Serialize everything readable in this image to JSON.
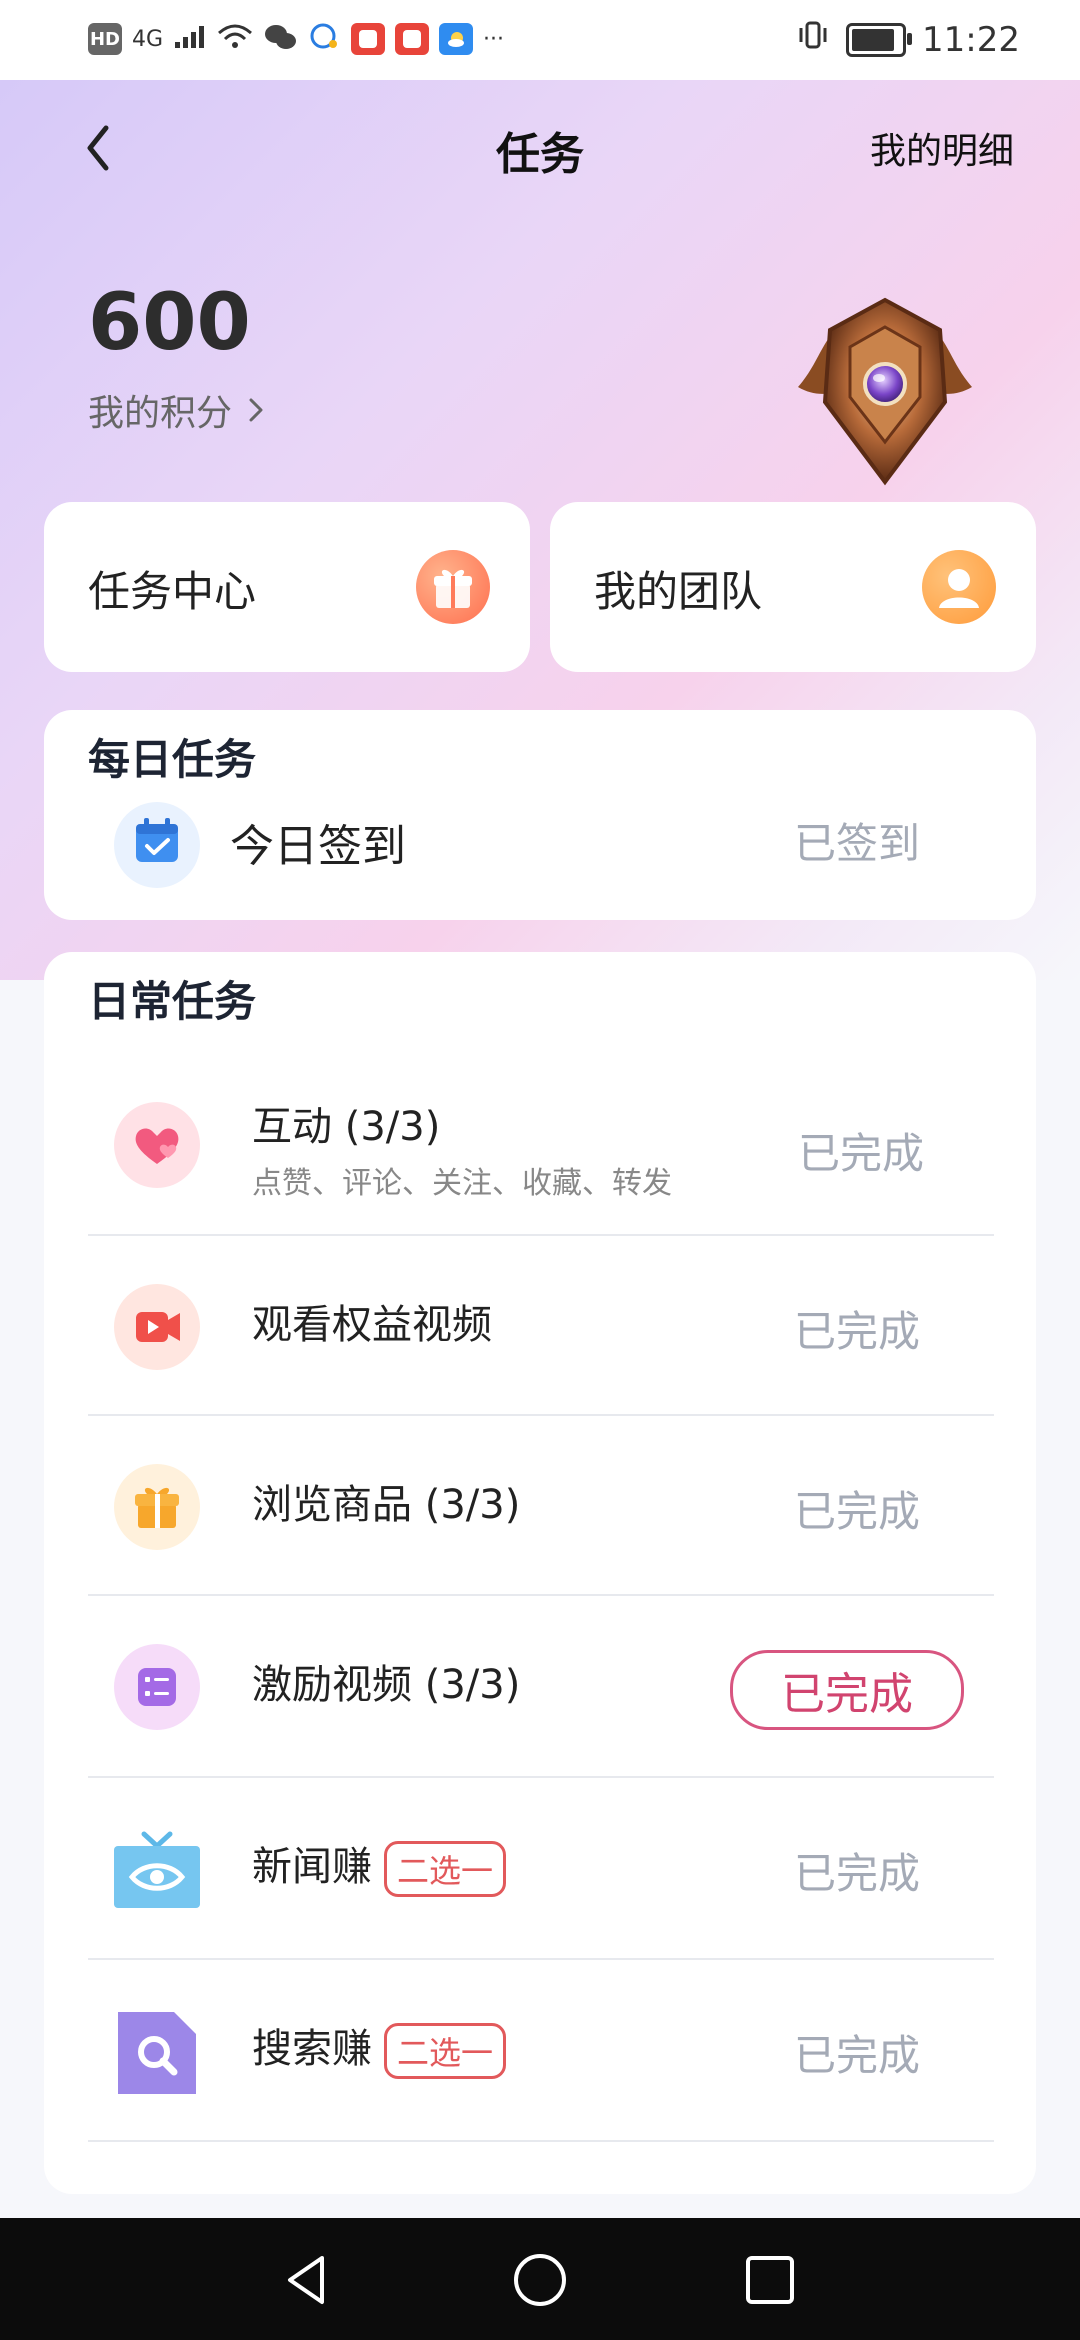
{
  "status_bar": {
    "left_badge": "HD",
    "signal": "4G",
    "right_time": "11:22",
    "dots": "···"
  },
  "header": {
    "title": "任务",
    "detail_link": "我的明细"
  },
  "points": {
    "value": "600",
    "label": "我的积分"
  },
  "quick_actions": [
    {
      "label": "任务中心",
      "icon": "gift-icon"
    },
    {
      "label": "我的团队",
      "icon": "person-icon"
    }
  ],
  "daily": {
    "title": "每日任务",
    "items": [
      {
        "title": "今日签到",
        "status": "已签到",
        "icon": "calendar-check-icon"
      }
    ]
  },
  "routine": {
    "title": "日常任务",
    "items": [
      {
        "title": "互动 (3/3)",
        "subtitle": "点赞、评论、关注、收藏、转发",
        "status": "已完成",
        "icon": "heart-icon"
      },
      {
        "title": "观看权益视频",
        "status": "已完成",
        "icon": "video-icon"
      },
      {
        "title": "浏览商品 (3/3)",
        "status": "已完成",
        "icon": "gift-icon"
      },
      {
        "title": "激励视频 (3/3)",
        "status": "已完成",
        "icon": "list-icon",
        "highlight": true
      },
      {
        "title": "新闻赚",
        "tag": "二选一",
        "status": "已完成",
        "icon": "tv-icon"
      },
      {
        "title": "搜索赚",
        "tag": "二选一",
        "status": "已完成",
        "icon": "search-doc-icon"
      }
    ]
  },
  "colors": {
    "accent": "#d85580",
    "tag": "#e2595b",
    "muted_status": "#a4aab6"
  }
}
